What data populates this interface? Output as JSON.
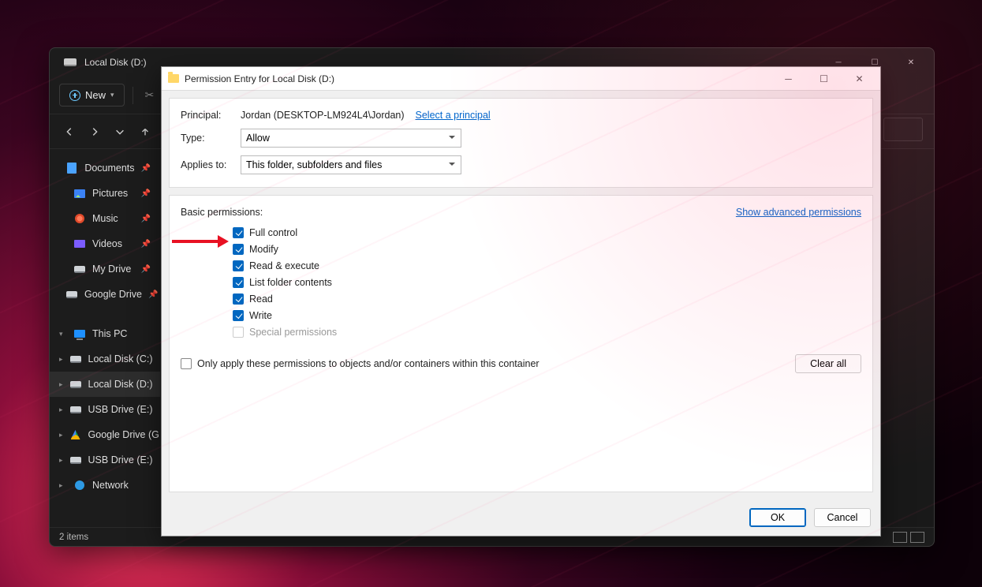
{
  "explorer": {
    "title": "Local Disk (D:)",
    "new_btn": "New",
    "sidebar_quick": [
      {
        "label": "Documents",
        "icon": "ic-doc"
      },
      {
        "label": "Pictures",
        "icon": "ic-pic"
      },
      {
        "label": "Music",
        "icon": "ic-music"
      },
      {
        "label": "Videos",
        "icon": "ic-vid"
      },
      {
        "label": "My Drive",
        "icon": "ic-drive"
      },
      {
        "label": "Google Drive",
        "icon": "ic-drive"
      }
    ],
    "this_pc_label": "This PC",
    "drives": [
      {
        "label": "Local Disk (C:)",
        "icon": "ic-drive",
        "selected": false
      },
      {
        "label": "Local Disk (D:)",
        "icon": "ic-drive",
        "selected": true
      },
      {
        "label": "USB Drive (E:)",
        "icon": "ic-drive",
        "selected": false
      },
      {
        "label": "Google Drive (G:)",
        "icon": "ic-gd",
        "selected": false
      },
      {
        "label": "USB Drive (E:)",
        "icon": "ic-drive",
        "selected": false
      },
      {
        "label": "Network",
        "icon": "ic-net",
        "selected": false
      }
    ],
    "status": "2 items"
  },
  "dialog": {
    "title": "Permission Entry for Local Disk (D:)",
    "principal_label": "Principal:",
    "principal_value": "Jordan (DESKTOP-LM924L4\\Jordan)",
    "select_principal": "Select a principal",
    "type_label": "Type:",
    "type_value": "Allow",
    "applies_label": "Applies to:",
    "applies_value": "This folder, subfolders and files",
    "basic_label": "Basic permissions:",
    "show_advanced": "Show advanced permissions",
    "permissions": [
      {
        "label": "Full control",
        "checked": true,
        "disabled": false
      },
      {
        "label": "Modify",
        "checked": true,
        "disabled": false
      },
      {
        "label": "Read & execute",
        "checked": true,
        "disabled": false
      },
      {
        "label": "List folder contents",
        "checked": true,
        "disabled": false
      },
      {
        "label": "Read",
        "checked": true,
        "disabled": false
      },
      {
        "label": "Write",
        "checked": true,
        "disabled": false
      },
      {
        "label": "Special permissions",
        "checked": false,
        "disabled": true
      }
    ],
    "only_apply": "Only apply these permissions to objects and/or containers within this container",
    "only_apply_checked": false,
    "clear_all": "Clear all",
    "ok": "OK",
    "cancel": "Cancel"
  }
}
